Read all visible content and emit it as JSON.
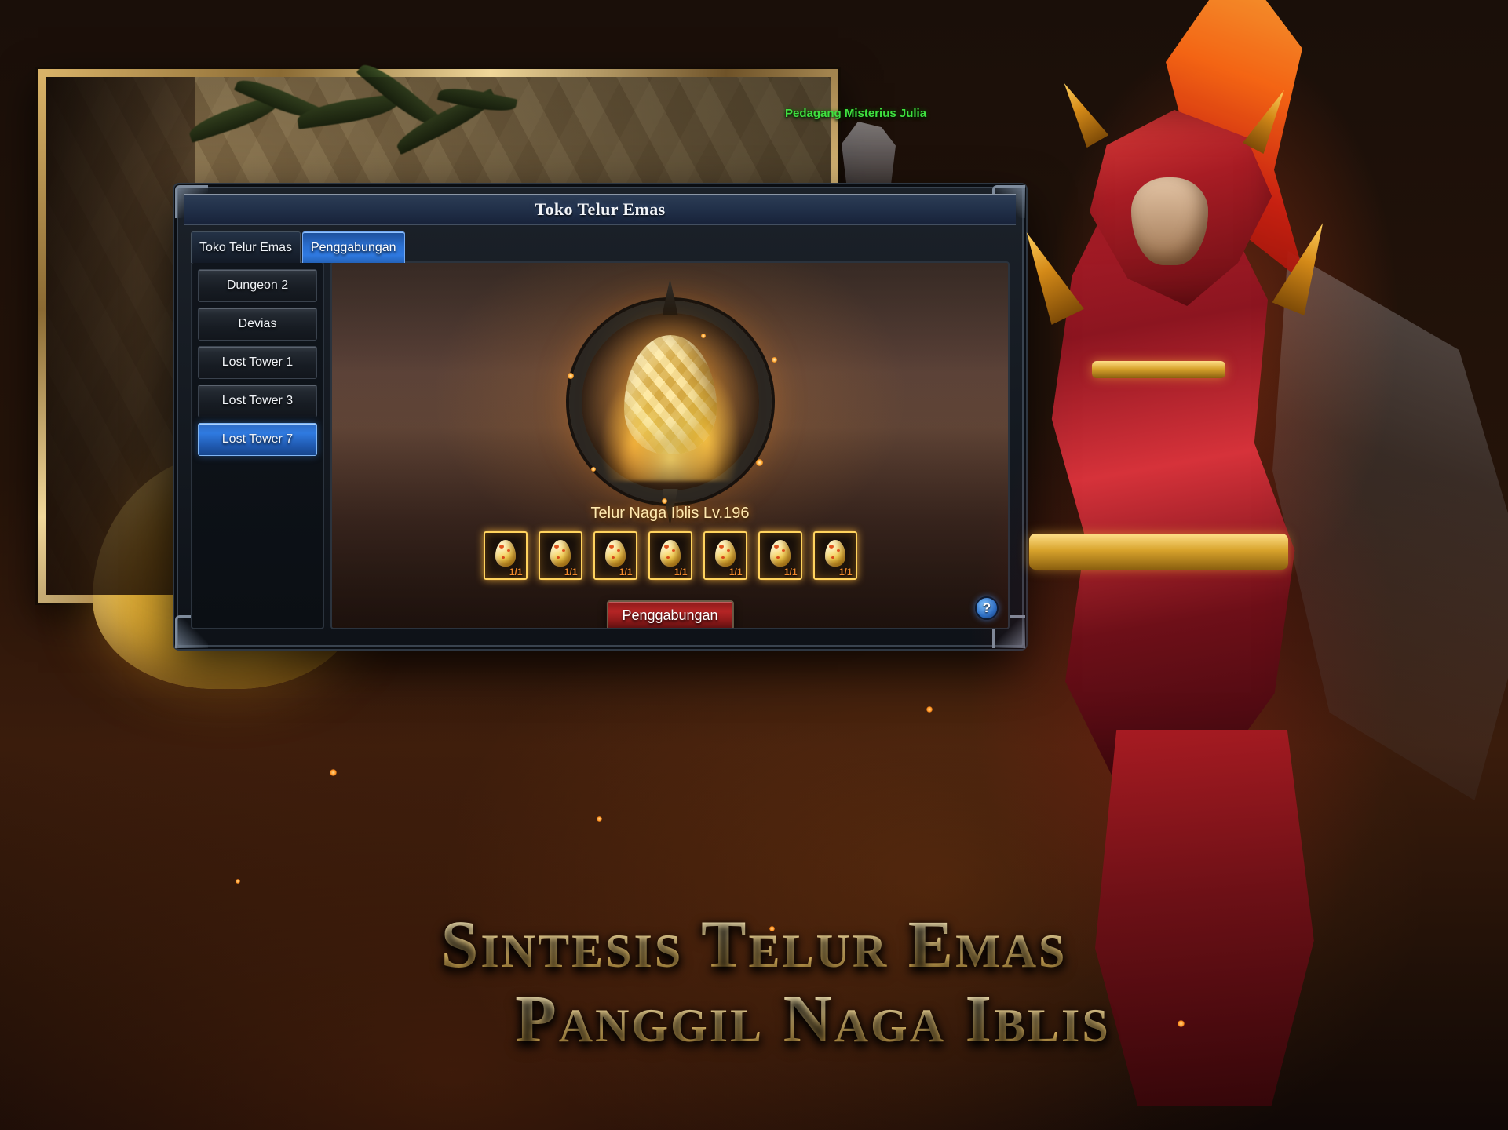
{
  "scene": {
    "npc_label": "Pedagang Misterius Julia"
  },
  "dialog": {
    "title": "Toko Telur Emas",
    "tabs": [
      {
        "label": "Toko Telur Emas",
        "active": false
      },
      {
        "label": "Penggabungan",
        "active": true
      }
    ],
    "sidebar": {
      "items": [
        {
          "label": "Dungeon 2",
          "selected": false
        },
        {
          "label": "Devias",
          "selected": false
        },
        {
          "label": "Lost Tower 1",
          "selected": false
        },
        {
          "label": "Lost Tower 3",
          "selected": false
        },
        {
          "label": "Lost Tower 7",
          "selected": true
        }
      ]
    },
    "content": {
      "item_title": "Telur Naga Iblis Lv.196",
      "slots": [
        {
          "icon": "golden-egg-icon",
          "count": "1/1"
        },
        {
          "icon": "golden-egg-icon",
          "count": "1/1"
        },
        {
          "icon": "golden-egg-icon",
          "count": "1/1"
        },
        {
          "icon": "golden-egg-icon",
          "count": "1/1"
        },
        {
          "icon": "golden-egg-icon",
          "count": "1/1"
        },
        {
          "icon": "golden-egg-icon",
          "count": "1/1"
        },
        {
          "icon": "golden-egg-icon",
          "count": "1/1"
        }
      ],
      "merge_button": "Penggabungan",
      "help_button": "?"
    }
  },
  "headline": {
    "line1": "Sintesis Telur Emas",
    "line2": "Panggil Naga Iblis"
  },
  "colors": {
    "accent_blue": "#2f79e0",
    "gold": "#ffd35e",
    "crimson": "#b52525",
    "npc_green": "#3fe03f",
    "headline_gold": "#f3dda4",
    "slot_count": "#f0892c"
  }
}
